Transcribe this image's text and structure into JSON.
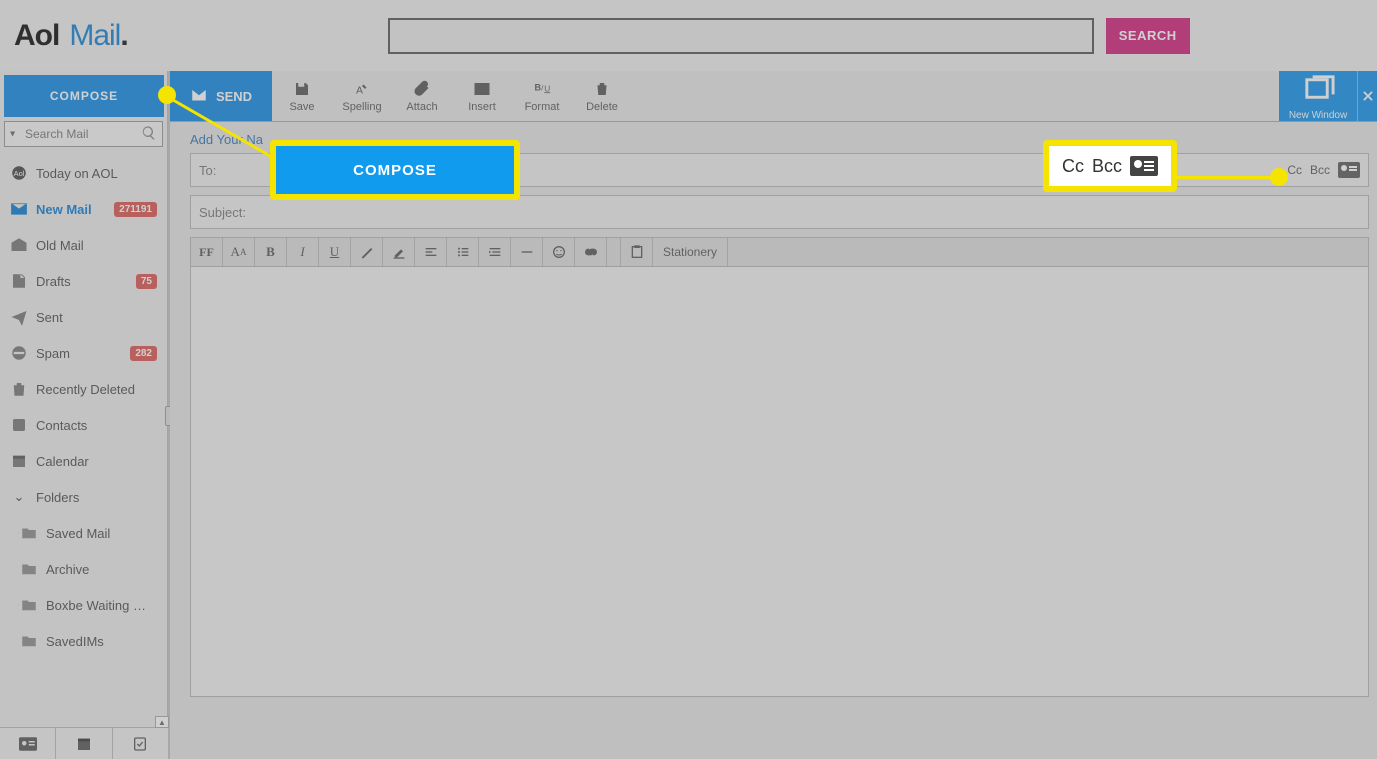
{
  "logo": {
    "aol": "Aol",
    "mail": "Mail",
    "dot": "."
  },
  "header": {
    "search_placeholder": "",
    "search_btn": "SEARCH"
  },
  "sidebar": {
    "compose": "COMPOSE",
    "search_placeholder": "Search Mail",
    "items": [
      {
        "label": "Today on AOL"
      },
      {
        "label": "New Mail",
        "badge": "271191",
        "active": true
      },
      {
        "label": "Old Mail"
      },
      {
        "label": "Drafts",
        "badge": "75"
      },
      {
        "label": "Sent"
      },
      {
        "label": "Spam",
        "badge": "282"
      },
      {
        "label": "Recently Deleted"
      },
      {
        "label": "Contacts"
      },
      {
        "label": "Calendar"
      }
    ],
    "folders_label": "Folders",
    "folders": [
      {
        "label": "Saved Mail"
      },
      {
        "label": "Archive"
      },
      {
        "label": "Boxbe Waiting …"
      },
      {
        "label": "SavedIMs"
      }
    ]
  },
  "toolbar": {
    "send": "SEND",
    "save": "Save",
    "spelling": "Spelling",
    "attach": "Attach",
    "insert": "Insert",
    "format": "Format",
    "delete": "Delete",
    "new_window": "New Window"
  },
  "compose": {
    "add_name": "Add Your Na",
    "to_label": "To:",
    "cc": "Cc",
    "bcc": "Bcc",
    "subject_label": "Subject:"
  },
  "editor": {
    "stationery": "Stationery"
  },
  "callout": {
    "compose": "COMPOSE",
    "cc": "Cc",
    "bcc": "Bcc"
  }
}
